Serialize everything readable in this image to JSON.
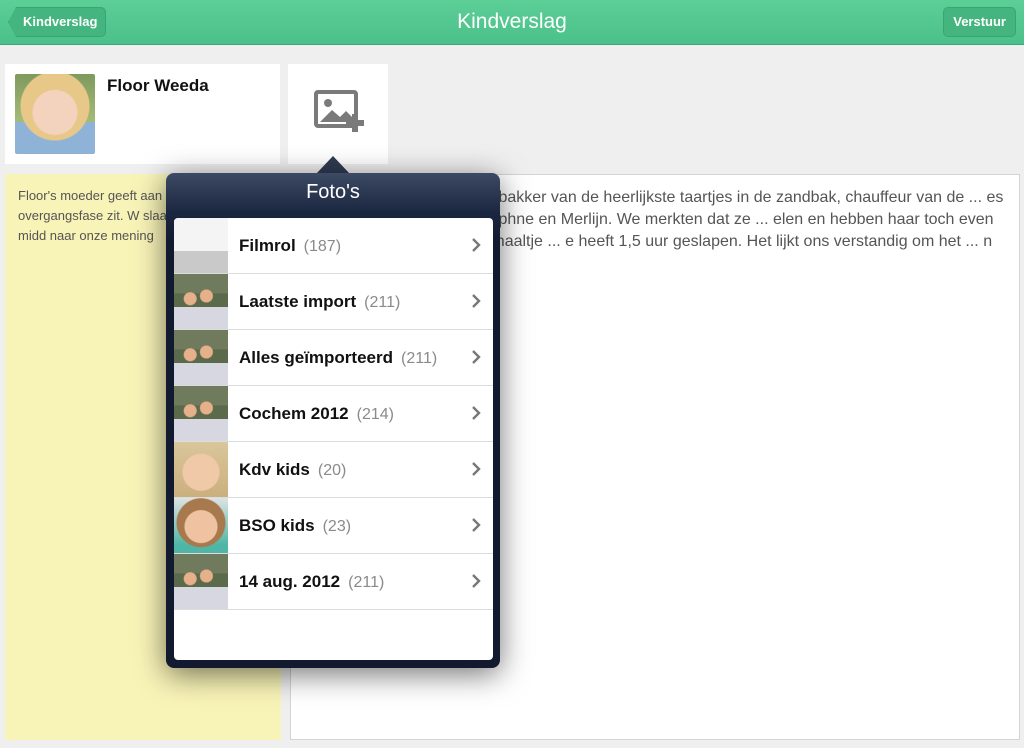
{
  "navbar": {
    "title": "Kindverslag",
    "back_label": "Kindverslag",
    "send_label": "Verstuur",
    "color": "#4cc08a"
  },
  "child": {
    "name": "Floor Weeda"
  },
  "add_photo": {
    "icon": "add-photo-icon"
  },
  "note": {
    "text": "Floor's moeder geeft aan dat Floor in een overgangsfase zit. W slaapje meer in de midd naar onze mening",
    "color": "#f8f3b7"
  },
  "report": {
    "text": "Floor is vandaag een echte bakker van de heerlijkste taartjes in de zandbak, chauffeur van de ... es in een meidengroep met Daphne en Merlijn. We merkten dat ze ... elen en hebben haar toch even op bed gelegd. Met een verhaaltje ... e heeft 1,5 uur geslapen. Het lijkt ons verstandig om het ... n in te houden."
  },
  "popover": {
    "title": "Foto's",
    "albums": [
      {
        "name": "Filmrol",
        "count": "(187)",
        "thumb": "screen"
      },
      {
        "name": "Laatste import",
        "count": "(211)",
        "thumb": "group"
      },
      {
        "name": "Alles geïmporteerd",
        "count": "(211)",
        "thumb": "group"
      },
      {
        "name": "Cochem 2012",
        "count": "(214)",
        "thumb": "group"
      },
      {
        "name": "Kdv kids",
        "count": "(20)",
        "thumb": "boy"
      },
      {
        "name": "BSO kids",
        "count": "(23)",
        "thumb": "girl"
      },
      {
        "name": "14 aug. 2012",
        "count": "(211)",
        "thumb": "group"
      }
    ]
  }
}
